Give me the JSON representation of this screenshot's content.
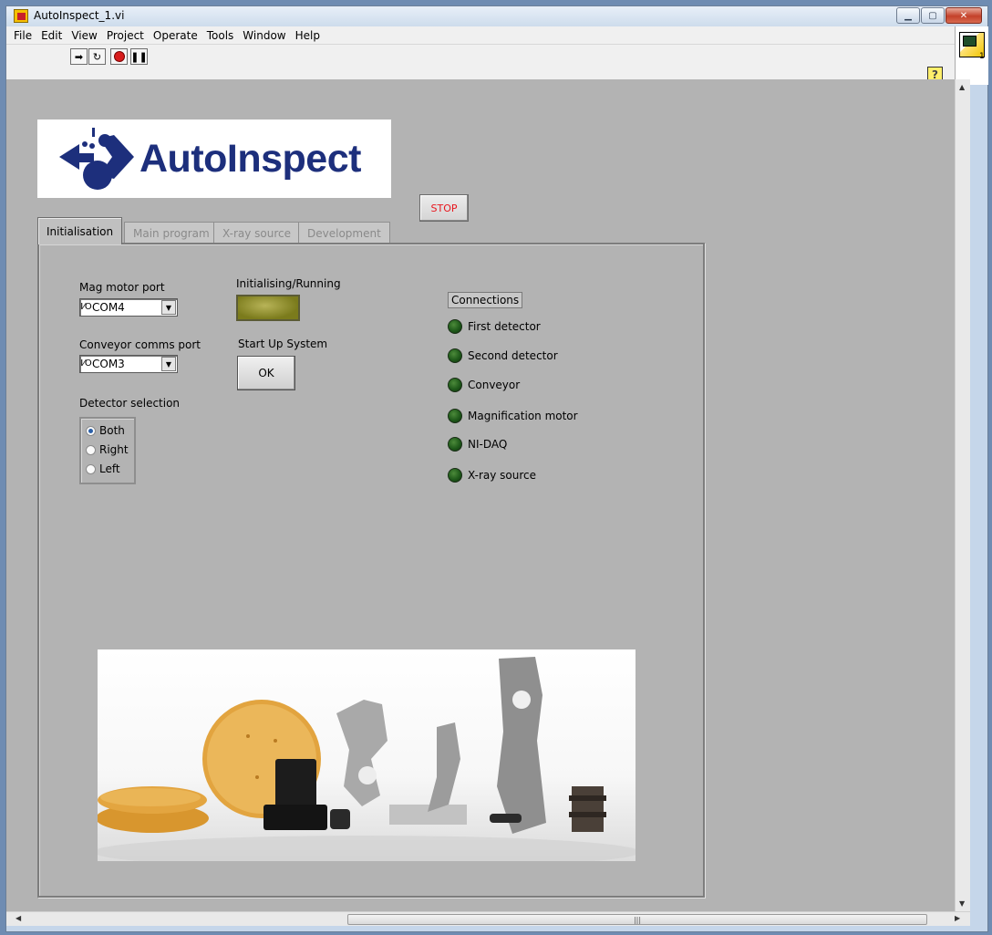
{
  "window": {
    "title": "AutoInspect_1.vi"
  },
  "menu": [
    "File",
    "Edit",
    "View",
    "Project",
    "Operate",
    "Tools",
    "Window",
    "Help"
  ],
  "toolbar": {
    "help_label": "?"
  },
  "vi_icon": {
    "number": "1"
  },
  "logo": {
    "text": "AutoInspect"
  },
  "stop_button": {
    "label": "STOP"
  },
  "tabs": [
    {
      "label": "Initialisation",
      "active": true
    },
    {
      "label": "Main program",
      "active": false
    },
    {
      "label": "X-ray source",
      "active": false
    },
    {
      "label": "Development",
      "active": false
    }
  ],
  "init": {
    "mag_motor_port": {
      "label": "Mag motor port",
      "value": "COM4"
    },
    "conveyor_port": {
      "label": "Conveyor comms port",
      "value": "COM3"
    },
    "detector_selection": {
      "label": "Detector selection",
      "options": [
        "Both",
        "Right",
        "Left"
      ],
      "selected": "Both"
    },
    "running_indicator": {
      "label": "Initialising/Running"
    },
    "startup": {
      "label": "Start Up System",
      "button": "OK"
    },
    "connections": {
      "title": "Connections",
      "items": [
        "First detector",
        "Second detector",
        "Conveyor",
        "Magnification motor",
        "NI-DAQ",
        "X-ray source"
      ]
    }
  },
  "colors": {
    "panel": "#b3b3b3",
    "logo_blue": "#1d2f7c",
    "stop_red": "#e8161d",
    "led_green": "#1f5a1a"
  }
}
